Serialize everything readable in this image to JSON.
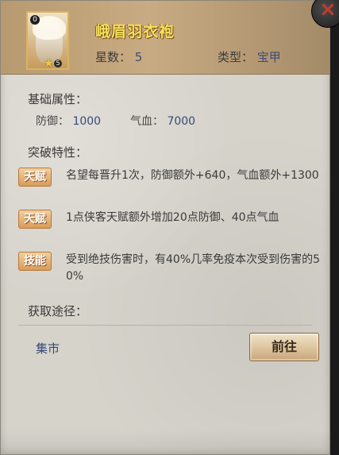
{
  "header": {
    "item_name": "峨眉羽衣袍",
    "portrait_level": "0",
    "portrait_star_count": "5",
    "stars_label": "星数：",
    "stars_value": "5",
    "type_label": "类型：",
    "type_value": "宝甲"
  },
  "base_attributes": {
    "title": "基础属性：",
    "defense_label": "防御：",
    "defense_value": "1000",
    "hp_label": "气血：",
    "hp_value": "7000"
  },
  "breakthrough": {
    "title": "突破特性：",
    "traits": [
      {
        "badge": "天赋",
        "text": "名望每晋升1次，防御额外+640，气血额外+1300"
      },
      {
        "badge": "天赋",
        "text": "1点侠客天赋额外增加20点防御、40点气血"
      },
      {
        "badge": "技能",
        "text": "受到绝技伤害时，有40%几率免疫本次受到伤害的50%"
      }
    ]
  },
  "acquire": {
    "title": "获取途径：",
    "source": "集市",
    "go_button": "前往"
  },
  "icons": {
    "close": "close-icon",
    "star": "star-icon"
  },
  "colors": {
    "item_name": "#f6e15b",
    "value_text": "#36497a",
    "badge": "#d89c58"
  }
}
